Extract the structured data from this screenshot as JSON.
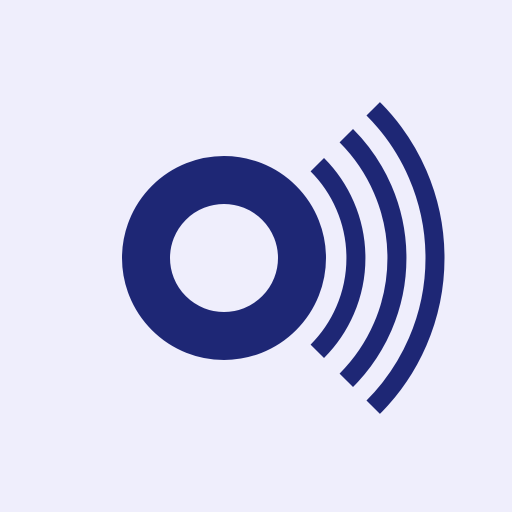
{
  "icon": {
    "name": "broadcast-signal-icon",
    "background_color": "#EFEEFC",
    "foreground_color": "#1E2775"
  }
}
